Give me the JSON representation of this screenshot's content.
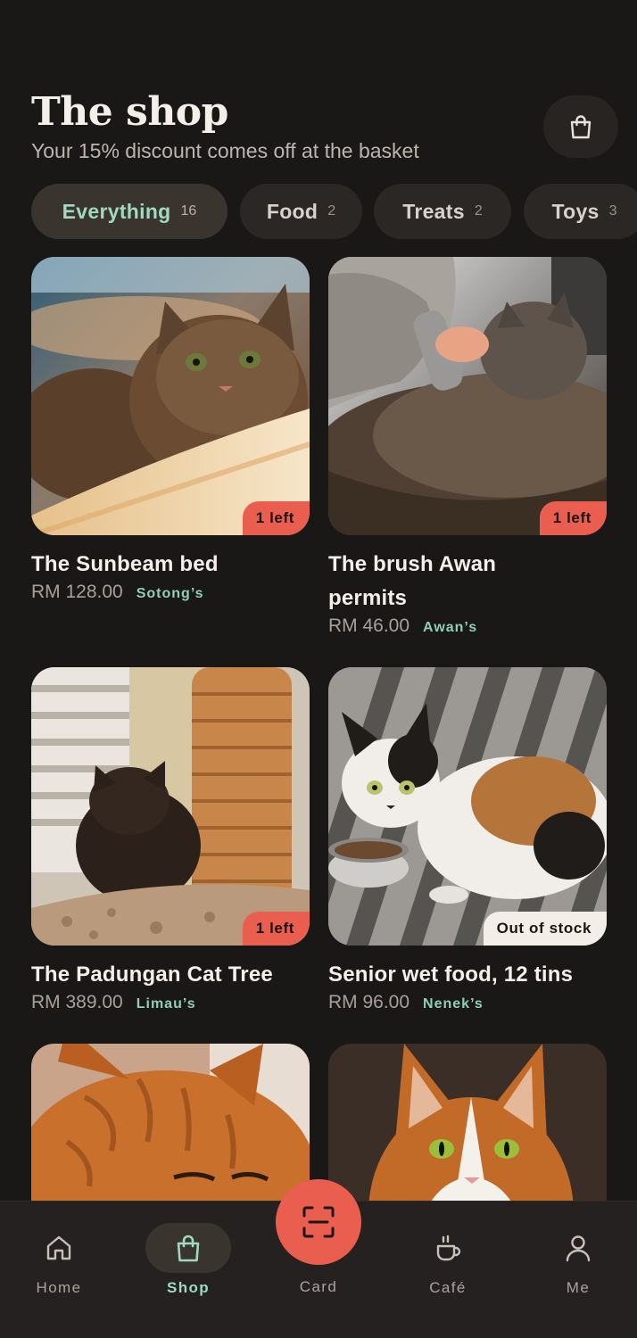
{
  "header": {
    "title": "The shop",
    "subtitle": "Your 15% discount comes off at the basket",
    "basket_icon": "shopping-bag-icon"
  },
  "categories": [
    {
      "label": "Everything",
      "count": "16",
      "active": true
    },
    {
      "label": "Food",
      "count": "2",
      "active": false
    },
    {
      "label": "Treats",
      "count": "2",
      "active": false
    },
    {
      "label": "Toys",
      "count": "3",
      "active": false
    }
  ],
  "products": [
    {
      "title": "The Sunbeam bed",
      "price": "RM 128.00",
      "maker": "Sotong’s",
      "stock": "1 left"
    },
    {
      "title": "The brush Awan permits",
      "price": "RM 46.00",
      "maker": "Awan’s",
      "stock": "1 left"
    },
    {
      "title": "The Padungan Cat Tree",
      "price": "RM 389.00",
      "maker": "Limau’s",
      "stock": "1 left"
    },
    {
      "title": "Senior wet food, 12 tins",
      "price": "RM 96.00",
      "maker": "Nenek’s",
      "stock": "Out of stock"
    }
  ],
  "nav": {
    "items": [
      {
        "label": "Home",
        "icon": "home-icon"
      },
      {
        "label": "Shop",
        "icon": "shopping-bag-icon",
        "active": true
      },
      {
        "label": "Card",
        "icon": "scan-card-icon"
      },
      {
        "label": "Café",
        "icon": "coffee-cup-icon"
      },
      {
        "label": "Me",
        "icon": "person-icon"
      }
    ]
  },
  "colors": {
    "background": "#1a1817",
    "accent_coral": "#ea5e4f",
    "accent_mint": "#9fd8c3",
    "surface": "#2a2725"
  }
}
